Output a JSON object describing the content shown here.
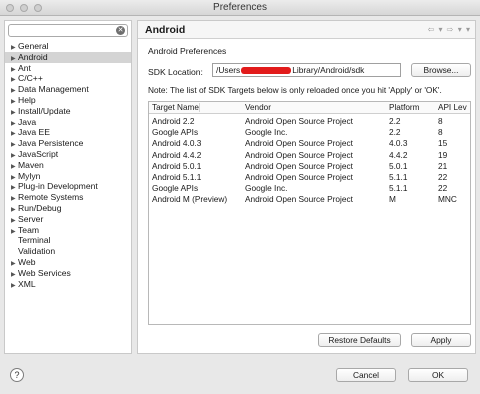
{
  "window": {
    "title": "Preferences"
  },
  "sidebar": {
    "filter_value": "",
    "items": [
      {
        "label": "General",
        "expandable": true,
        "selected": false
      },
      {
        "label": "Android",
        "expandable": true,
        "selected": true
      },
      {
        "label": "Ant",
        "expandable": true,
        "selected": false
      },
      {
        "label": "C/C++",
        "expandable": true,
        "selected": false
      },
      {
        "label": "Data Management",
        "expandable": true,
        "selected": false
      },
      {
        "label": "Help",
        "expandable": true,
        "selected": false
      },
      {
        "label": "Install/Update",
        "expandable": true,
        "selected": false
      },
      {
        "label": "Java",
        "expandable": true,
        "selected": false
      },
      {
        "label": "Java EE",
        "expandable": true,
        "selected": false
      },
      {
        "label": "Java Persistence",
        "expandable": true,
        "selected": false
      },
      {
        "label": "JavaScript",
        "expandable": true,
        "selected": false
      },
      {
        "label": "Maven",
        "expandable": true,
        "selected": false
      },
      {
        "label": "Mylyn",
        "expandable": true,
        "selected": false
      },
      {
        "label": "Plug-in Development",
        "expandable": true,
        "selected": false
      },
      {
        "label": "Remote Systems",
        "expandable": true,
        "selected": false
      },
      {
        "label": "Run/Debug",
        "expandable": true,
        "selected": false
      },
      {
        "label": "Server",
        "expandable": true,
        "selected": false
      },
      {
        "label": "Team",
        "expandable": true,
        "selected": false
      },
      {
        "label": "Terminal",
        "expandable": false,
        "selected": false
      },
      {
        "label": "Validation",
        "expandable": false,
        "selected": false
      },
      {
        "label": "Web",
        "expandable": true,
        "selected": false
      },
      {
        "label": "Web Services",
        "expandable": true,
        "selected": false
      },
      {
        "label": "XML",
        "expandable": true,
        "selected": false
      }
    ]
  },
  "page": {
    "title": "Android",
    "section_label": "Android Preferences",
    "sdk_label": "SDK Location:",
    "sdk_path_prefix": "/Users",
    "sdk_path_suffix": "Library/Android/sdk",
    "browse_label": "Browse...",
    "note": "Note: The list of SDK Targets below is only reloaded once you hit 'Apply' or 'OK'.",
    "table": {
      "columns": [
        "Target Name",
        "Vendor",
        "Platform",
        "API Lev"
      ],
      "rows": [
        [
          "Android 2.2",
          "Android Open Source Project",
          "2.2",
          "8"
        ],
        [
          "Google APIs",
          "Google Inc.",
          "2.2",
          "8"
        ],
        [
          "Android 4.0.3",
          "Android Open Source Project",
          "4.0.3",
          "15"
        ],
        [
          "Android 4.4.2",
          "Android Open Source Project",
          "4.4.2",
          "19"
        ],
        [
          "Android 5.0.1",
          "Android Open Source Project",
          "5.0.1",
          "21"
        ],
        [
          "Android 5.1.1",
          "Android Open Source Project",
          "5.1.1",
          "22"
        ],
        [
          "Google APIs",
          "Google Inc.",
          "5.1.1",
          "22"
        ],
        [
          "Android M (Preview)",
          "Android Open Source Project",
          "M",
          "MNC"
        ]
      ]
    },
    "restore_label": "Restore Defaults",
    "apply_label": "Apply"
  },
  "footer": {
    "help_glyph": "?",
    "cancel_label": "Cancel",
    "ok_label": "OK"
  },
  "colors": {
    "redaction": "#e21b1b",
    "selection": "#d4d4d4"
  }
}
